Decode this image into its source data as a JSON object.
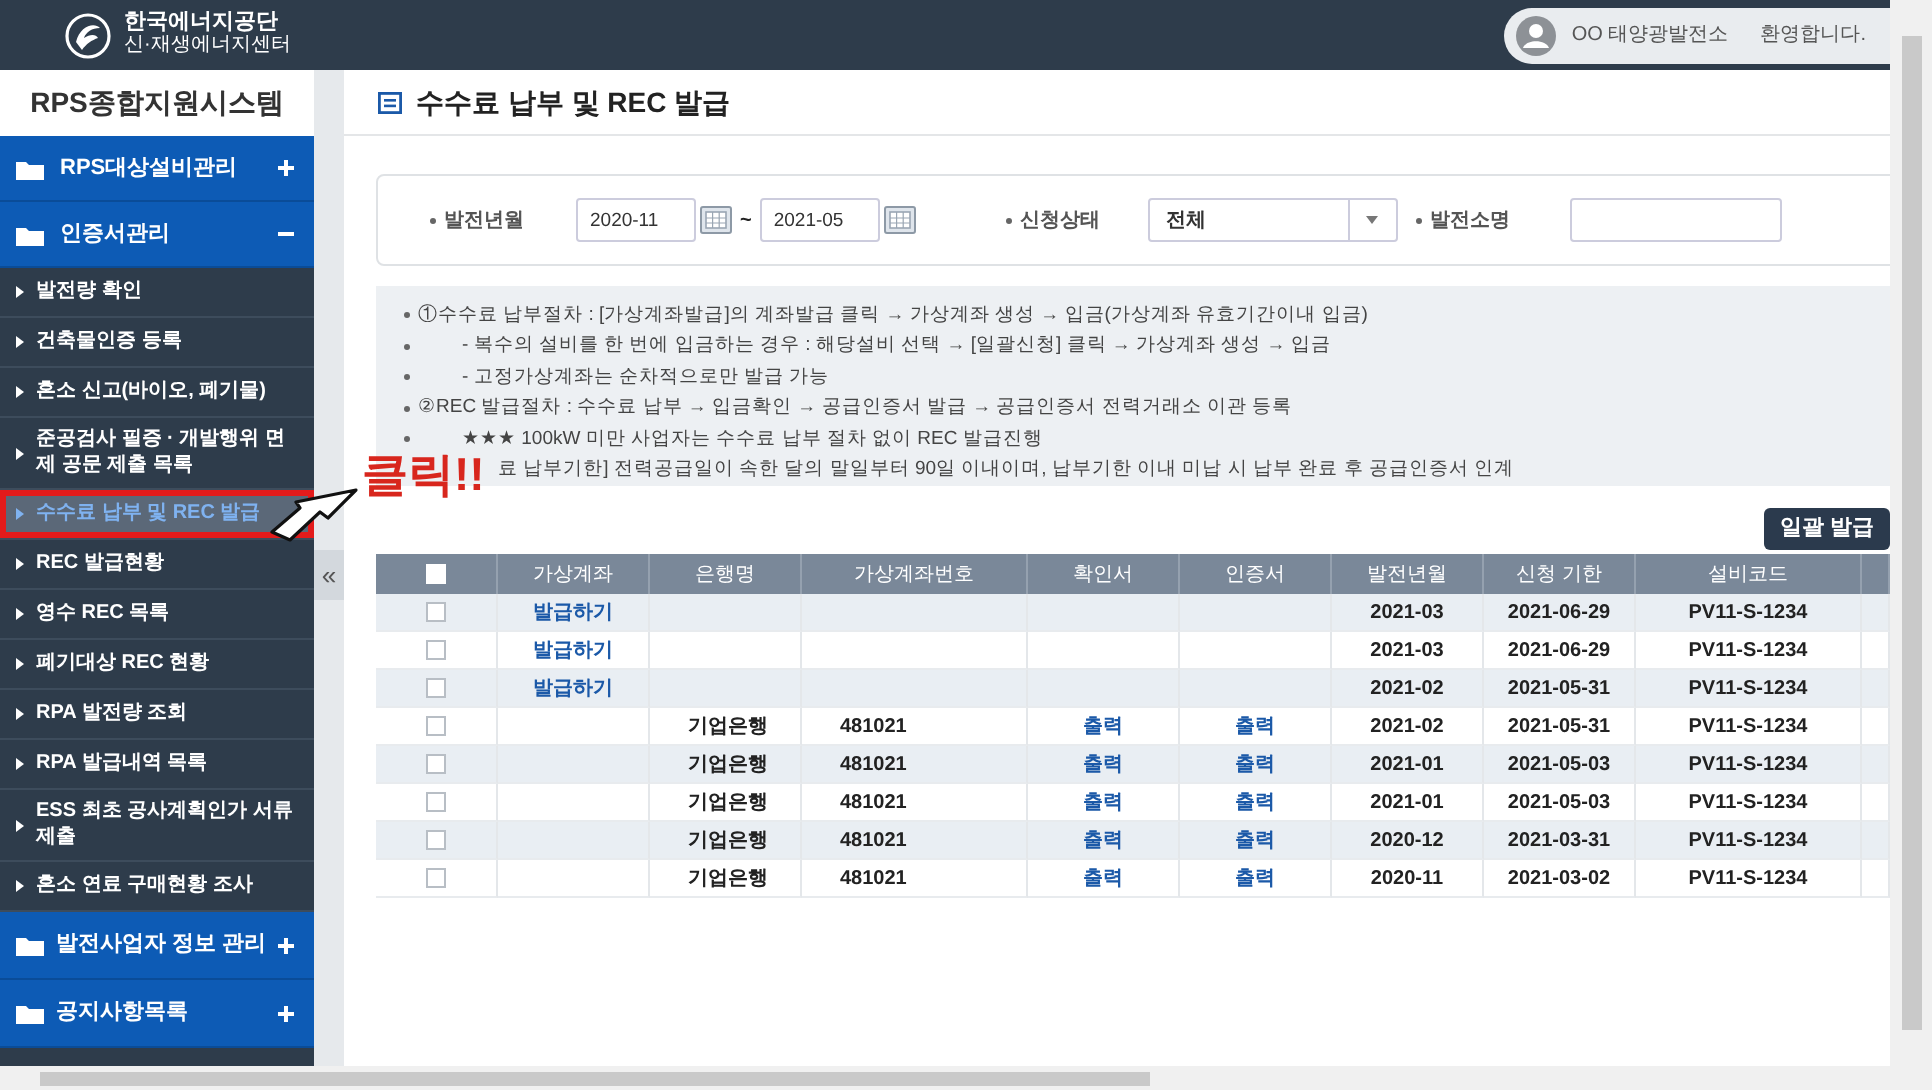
{
  "header": {
    "logo_lines": [
      "한국에너지공단",
      "신·재생에너지센터"
    ],
    "user": "OO 태양광발전소",
    "greeting": "환영합니다."
  },
  "sidebar": {
    "title": "RPS종합지원시스템",
    "collapse": "«",
    "groups": [
      {
        "label": "RPS대상설비관리",
        "expanded": false
      },
      {
        "label": "인증서관리",
        "expanded": true,
        "items": [
          {
            "label": "발전량 확인",
            "selected": false
          },
          {
            "label": "건축물인증 등록",
            "selected": false
          },
          {
            "label": "혼소 신고(바이오, 폐기물)",
            "selected": false
          },
          {
            "label": "준공검사 필증 · 개발행위 면제 공문 제출 목록",
            "selected": false
          },
          {
            "label": "수수료 납부 및 REC 발급",
            "selected": true
          },
          {
            "label": "REC 발급현황",
            "selected": false
          },
          {
            "label": "영수 REC 목록",
            "selected": false
          },
          {
            "label": "폐기대상 REC 현황",
            "selected": false
          },
          {
            "label": "RPA 발전량 조회",
            "selected": false
          },
          {
            "label": "RPA 발급내역 목록",
            "selected": false
          },
          {
            "label": "ESS 최초 공사계획인가 서류 제출",
            "selected": false
          },
          {
            "label": "혼소 연료 구매현황 조사",
            "selected": false
          }
        ]
      },
      {
        "label": "발전사업자 정보 관리",
        "expanded": false
      },
      {
        "label": "공지사항목록",
        "expanded": false
      }
    ]
  },
  "page_title": "수수료 납부 및 REC 발급",
  "filters": {
    "period_label": "발전년월",
    "from": "2020-11",
    "separator": "~",
    "to": "2021-05",
    "status_label": "신청상태",
    "status": "전체",
    "plant_label": "발전소명"
  },
  "notes": [
    {
      "kind": "item",
      "text": "①수수료 납부절차 : [가상계좌발급]의 계좌발급 클릭 → 가상계좌 생성 → 입금(가상계좌 유효기간이내 입금)"
    },
    {
      "kind": "sub",
      "text": "- 복수의 설비를 한 번에 입금하는 경우 : 해당설비 선택 → [일괄신청] 클릭 → 가상계좌 생성 → 입금"
    },
    {
      "kind": "sub",
      "text": "- 고정가상계좌는 순차적으로만 발급 가능"
    },
    {
      "kind": "item",
      "text": "②REC 발급절차 : 수수료 납부 → 입금확인 → 공급인증서 발급 → 공급인증서 전력거래소 이관 등록"
    },
    {
      "kind": "sub",
      "text": "★★★ 100kW 미만 사업자는 수수료 납부 절차 없이 REC 발급진행"
    },
    {
      "kind": "cut",
      "text": "료 납부기한] 전력공급일이 속한 달의 말일부터 90일 이내이며, 납부기한 이내 미납 시 납부 완료 후 공급인증서 인계"
    }
  ],
  "bulk_button": "일괄 발급",
  "table": {
    "header_checked": false,
    "columns": [
      {
        "label": "가상계좌",
        "kind": "link"
      },
      {
        "label": "은행명",
        "kind": "text"
      },
      {
        "label": "가상계좌번호",
        "kind": "text"
      },
      {
        "label": "확인서",
        "kind": "link"
      },
      {
        "label": "인증서",
        "kind": "link"
      },
      {
        "label": "발전년월",
        "kind": "text"
      },
      {
        "label": "신청 기한",
        "kind": "text"
      },
      {
        "label": "설비코드",
        "kind": "text"
      }
    ],
    "rows": [
      {
        "checked": false,
        "cells": [
          "발급하기",
          "",
          "",
          "",
          "",
          "2021-03",
          "2021-06-29",
          "PV11-S-1234"
        ]
      },
      {
        "checked": false,
        "cells": [
          "발급하기",
          "",
          "",
          "",
          "",
          "2021-03",
          "2021-06-29",
          "PV11-S-1234"
        ]
      },
      {
        "checked": false,
        "cells": [
          "발급하기",
          "",
          "",
          "",
          "",
          "2021-02",
          "2021-05-31",
          "PV11-S-1234"
        ]
      },
      {
        "checked": false,
        "cells": [
          "",
          "기업은행",
          "481021",
          "출력",
          "출력",
          "2021-02",
          "2021-05-31",
          "PV11-S-1234"
        ]
      },
      {
        "checked": false,
        "cells": [
          "",
          "기업은행",
          "481021",
          "출력",
          "출력",
          "2021-01",
          "2021-05-03",
          "PV11-S-1234"
        ]
      },
      {
        "checked": false,
        "cells": [
          "",
          "기업은행",
          "481021",
          "출력",
          "출력",
          "2021-01",
          "2021-05-03",
          "PV11-S-1234"
        ]
      },
      {
        "checked": false,
        "cells": [
          "",
          "기업은행",
          "481021",
          "출력",
          "출력",
          "2020-12",
          "2021-03-31",
          "PV11-S-1234"
        ]
      },
      {
        "checked": false,
        "cells": [
          "",
          "기업은행",
          "481021",
          "출력",
          "출력",
          "2020-11",
          "2021-03-02",
          "PV11-S-1234"
        ]
      }
    ]
  },
  "annotation": {
    "text": "클릭!!"
  }
}
